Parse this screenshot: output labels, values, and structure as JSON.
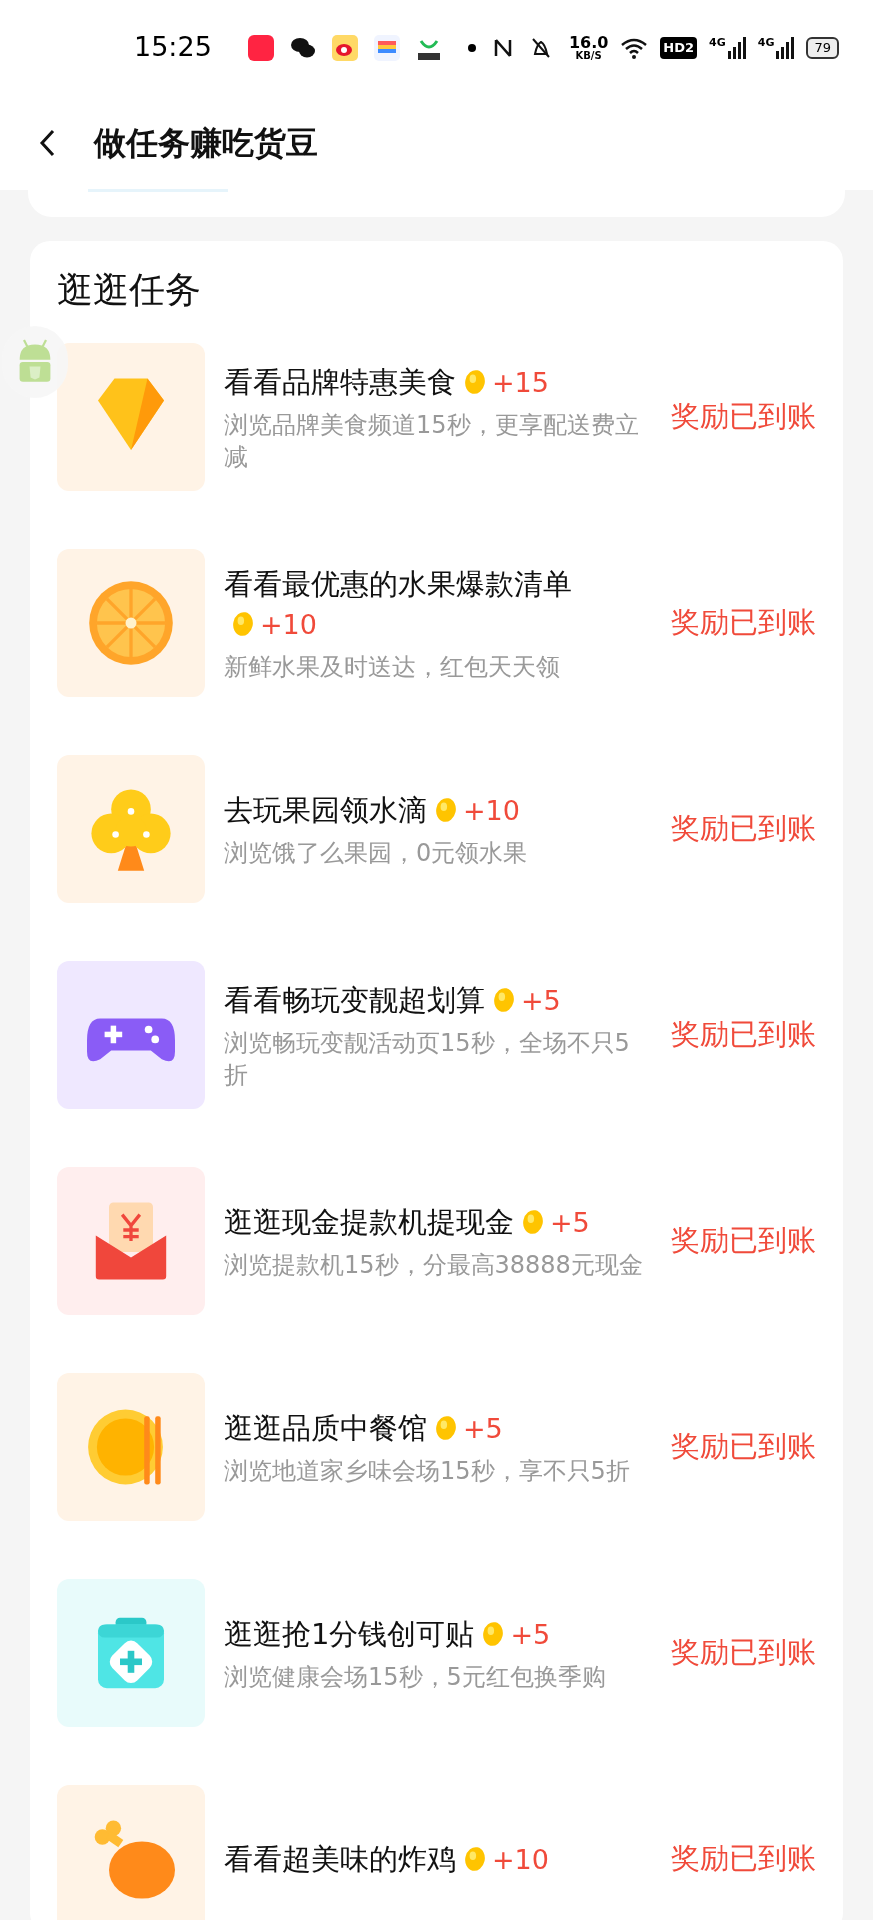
{
  "status_bar": {
    "time": "15:25",
    "speed_value": "16.0",
    "speed_unit": "KB/S",
    "hd_label": "HD2",
    "network_1": "4G",
    "network_2": "4G",
    "battery": "79"
  },
  "header": {
    "title": "做任务赚吃货豆"
  },
  "section": {
    "title": "逛逛任务",
    "tasks": [
      {
        "kind": "diamond",
        "title": "看看品牌特惠美食",
        "points": "+15",
        "desc": "浏览品牌美食频道15秒，更享配送费立减",
        "reward": "奖励已到账"
      },
      {
        "kind": "orange",
        "title": "看看最优惠的水果爆款清单",
        "points": "+10",
        "desc": "新鲜水果及时送达，红包天天领",
        "reward": "奖励已到账"
      },
      {
        "kind": "tree",
        "title": "去玩果园领水滴",
        "points": "+10",
        "desc": "浏览饿了么果园，0元领水果",
        "reward": "奖励已到账"
      },
      {
        "kind": "gamepad",
        "title": "看看畅玩变靓超划算",
        "points": "+5",
        "desc": "浏览畅玩变靓活动页15秒，全场不只5折",
        "reward": "奖励已到账"
      },
      {
        "kind": "envelope",
        "title": "逛逛现金提款机提现金",
        "points": "+5",
        "desc": "浏览提款机15秒，分最高38888元现金",
        "reward": "奖励已到账"
      },
      {
        "kind": "plate",
        "title": "逛逛品质中餐馆",
        "points": "+5",
        "desc": "浏览地道家乡味会场15秒，享不只5折",
        "reward": "奖励已到账"
      },
      {
        "kind": "kit",
        "title": "逛逛抢1分钱创可贴",
        "points": "+5",
        "desc": "浏览健康会场15秒，5元红包换季购",
        "reward": "奖励已到账"
      },
      {
        "kind": "drumstick",
        "title": "看看超美味的炸鸡",
        "points": "+10",
        "reward": "奖励已到账"
      }
    ]
  }
}
